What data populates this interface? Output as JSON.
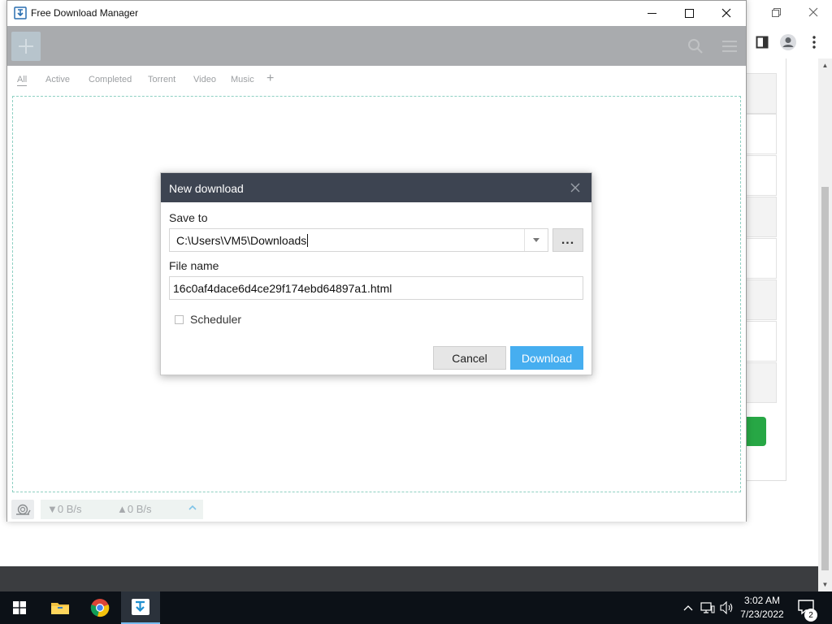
{
  "fdm": {
    "title": "Free Download Manager",
    "tabs": [
      {
        "label": "All"
      },
      {
        "label": "Active"
      },
      {
        "label": "Completed"
      },
      {
        "label": "Torrent"
      },
      {
        "label": "Video"
      },
      {
        "label": "Music"
      }
    ],
    "tab_add_label": "+",
    "status": {
      "down_speed": "▼0 B/s",
      "up_speed": "▲0 B/s"
    }
  },
  "dialog": {
    "title": "New download",
    "save_to_label": "Save to",
    "save_to_value": "C:\\Users\\VM5\\Downloads",
    "browse_label": "...",
    "file_name_label": "File name",
    "file_name_value": "16c0af4dace6d4ce29f174ebd64897a1.html",
    "scheduler_label": "Scheduler",
    "scheduler_checked": false,
    "cancel_label": "Cancel",
    "download_label": "Download"
  },
  "taskbar": {
    "time": "3:02 AM",
    "date": "7/23/2022",
    "notification_count": "2"
  },
  "colors": {
    "accent": "#46aef0",
    "dialog_header": "#3d4451",
    "toolbar": "#a9abae",
    "dropzone_border": "#8ed0c2",
    "taskbar": "#0c1117"
  }
}
